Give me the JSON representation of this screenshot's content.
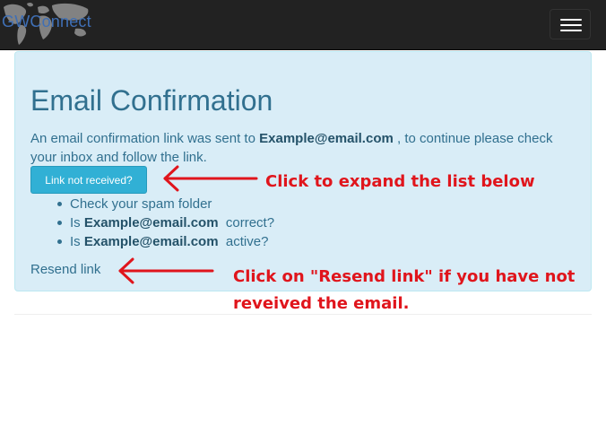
{
  "navbar": {
    "brand": "GWConnect",
    "toggle_icon": "hamburger-menu-icon"
  },
  "panel": {
    "title": "Email Confirmation",
    "message_prefix": "An email confirmation link was sent to ",
    "email": "Example@email.com",
    "message_suffix": " , to continue please check your inbox and follow the link.",
    "button_label": "Link not received?",
    "tips": {
      "spam": "Check your spam folder",
      "is_prefix": "Is ",
      "correct_suffix": "  correct?",
      "active_suffix": "  active?",
      "email": "Example@email.com"
    },
    "resend_label": "Resend link"
  },
  "annotations": {
    "note1": "Click to expand the list below",
    "note2_line1": "Click on \"Resend link\" if you have not",
    "note2_line2": "reveived the email.",
    "color": "#e0151c"
  },
  "colors": {
    "navbar_bg": "#222222",
    "panel_bg": "#d9edf7",
    "panel_text": "#31708f",
    "button_bg": "#31b0d5"
  }
}
